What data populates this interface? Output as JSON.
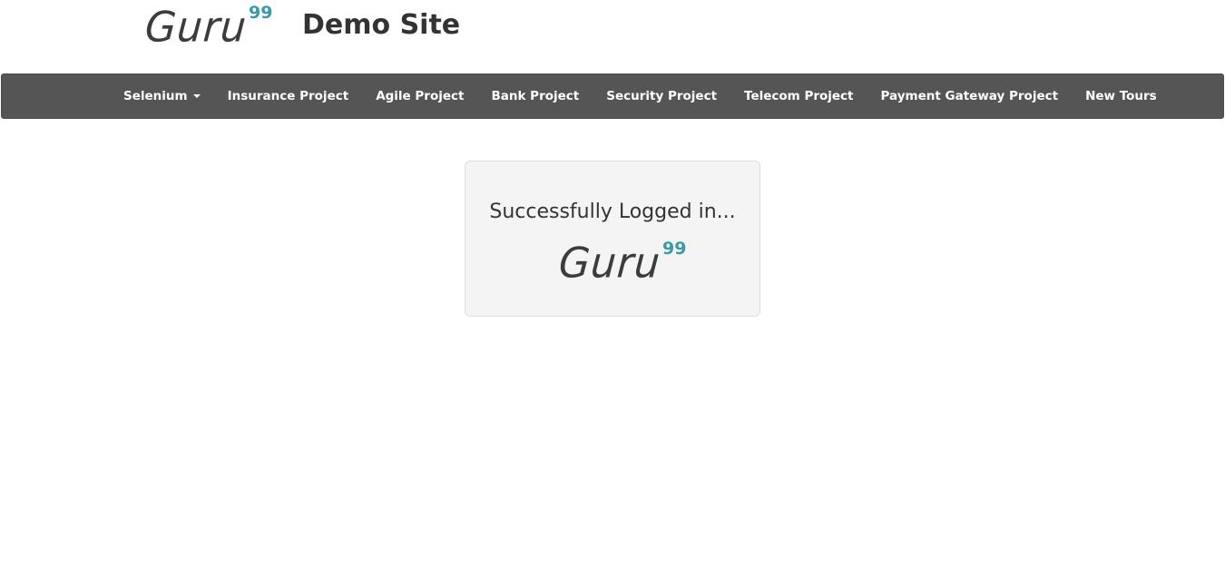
{
  "header": {
    "logo_text": "Guru",
    "logo_superscript": "99",
    "site_title": "Demo Site"
  },
  "nav": {
    "items": [
      {
        "label": "Selenium",
        "has_dropdown": true
      },
      {
        "label": "Insurance Project"
      },
      {
        "label": "Agile Project"
      },
      {
        "label": "Bank Project"
      },
      {
        "label": "Security Project"
      },
      {
        "label": "Telecom Project"
      },
      {
        "label": "Payment Gateway Project"
      },
      {
        "label": "New Tours"
      }
    ]
  },
  "main": {
    "message": "Successfully Logged in...",
    "logo_text": "Guru",
    "logo_superscript": "99"
  },
  "colors": {
    "navbar": "#555555",
    "accent": "#3a9aaa",
    "box_background": "#f4f4f4"
  }
}
